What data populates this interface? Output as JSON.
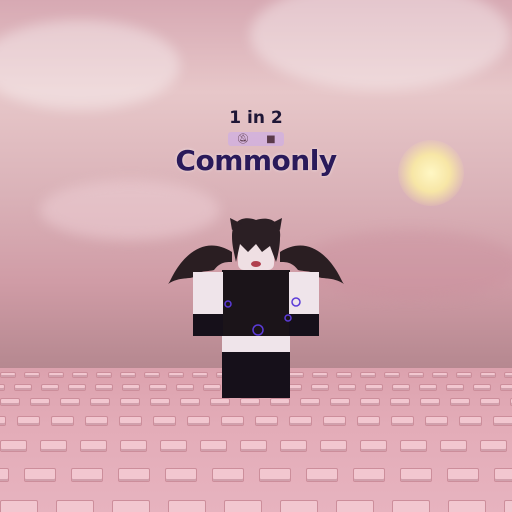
{
  "rarity_popup": {
    "odds": "1 in 2",
    "name": "Commonly",
    "icons": [
      "bell-off-icon",
      "camera-off-icon"
    ]
  },
  "colors": {
    "name_text": "#2a1a5a",
    "odds_text": "#1f1636",
    "icon_strip": "#cfafe1",
    "baseplate": "#e7b3bf",
    "sky": "#dcb5bb"
  }
}
